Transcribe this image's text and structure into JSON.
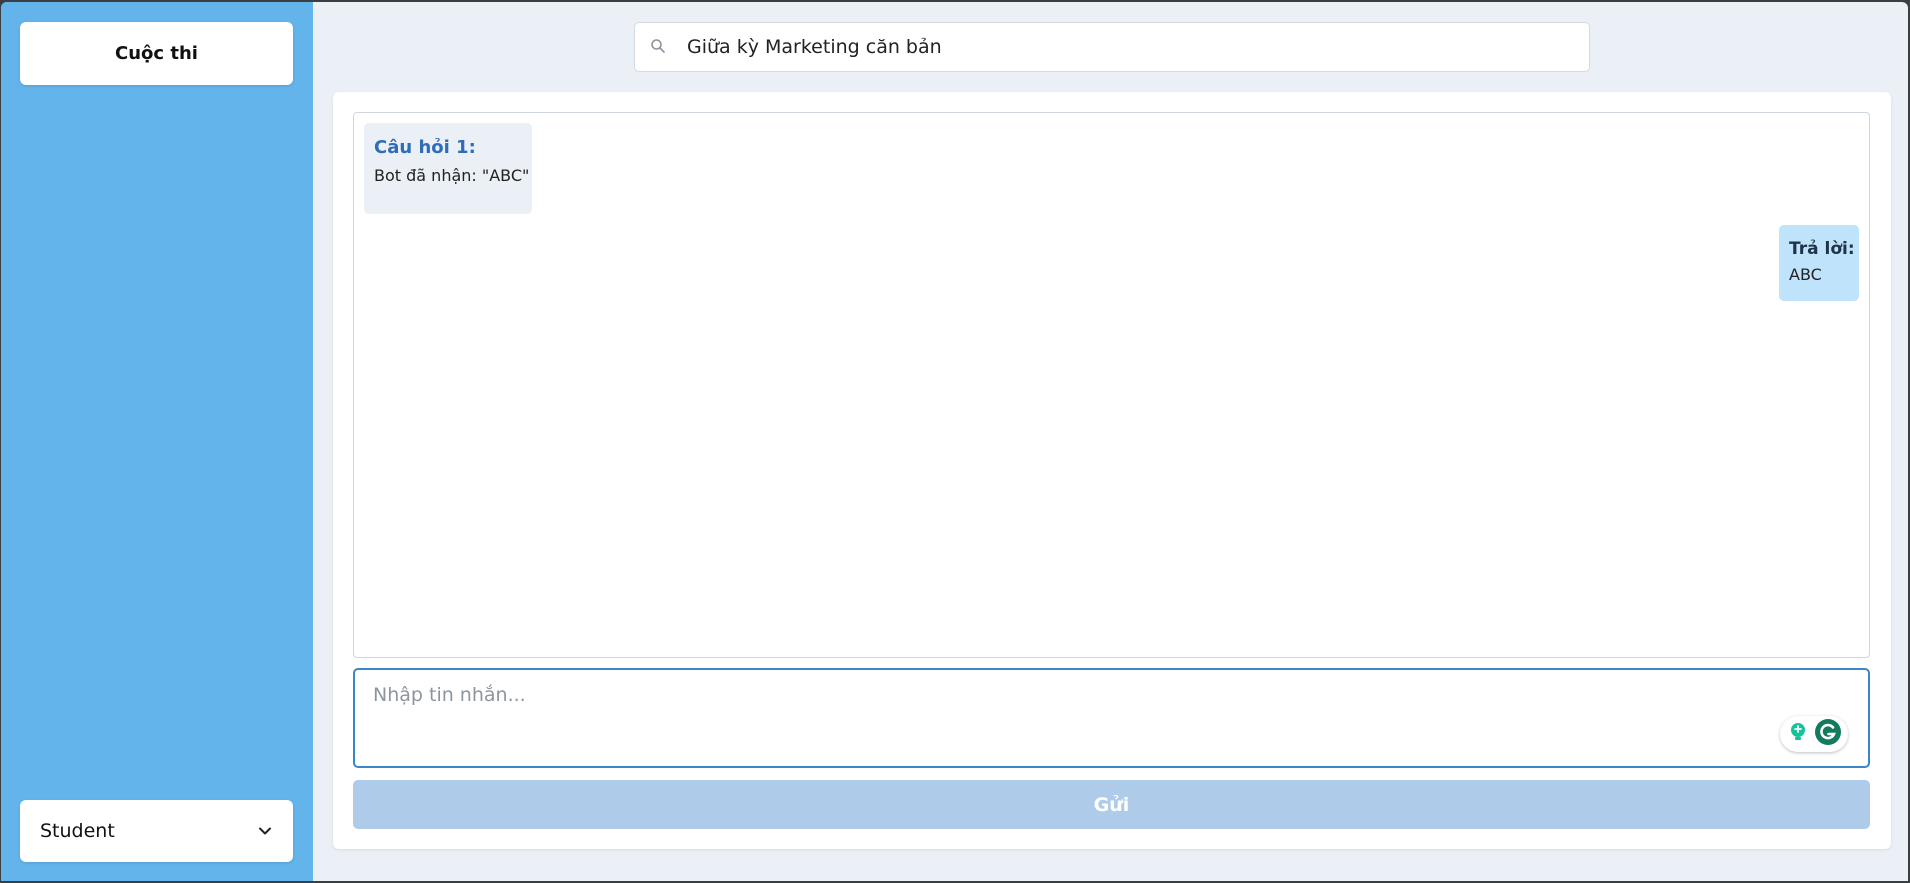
{
  "sidebar": {
    "contest_button_label": "Cuộc thi",
    "role_select": {
      "selected": "Student"
    }
  },
  "search": {
    "value": "Giữa kỳ Marketing căn bản"
  },
  "chat": {
    "messages": [
      {
        "sender": "bot",
        "title": "Câu hỏi 1:",
        "text": "Bot đã nhận: \"ABC\""
      },
      {
        "sender": "user",
        "title": "Trả lời:",
        "text": "ABC"
      }
    ]
  },
  "composer": {
    "placeholder": "Nhập tin nhắn...",
    "send_label": "Gửi"
  },
  "colors": {
    "sidebar_bg": "#64b4ec",
    "question_title": "#2f6db8",
    "answer_bubble": "#bfe3fa",
    "send_button_disabled": "#aecbe9",
    "grammarly_green": "#15c39a"
  }
}
